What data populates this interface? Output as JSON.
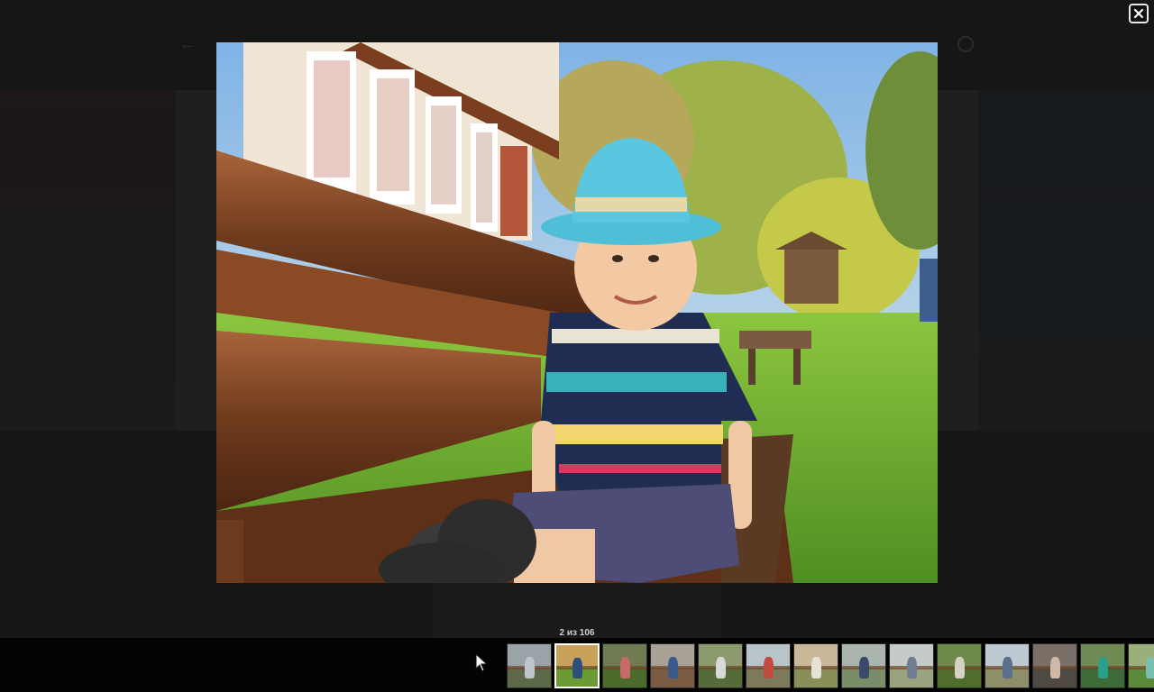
{
  "viewer": {
    "counter": "2 из 106",
    "close_icon": "close-icon"
  },
  "colors": {
    "overlay": "#141414",
    "filmstrip": "#030303",
    "selected_border": "#ffffff"
  },
  "thumbnails": [
    {
      "sky": "#9aa4a8",
      "ground": "#5d6a4a",
      "fig": "#c0c7cc",
      "selected": false
    },
    {
      "sky": "#c8a25a",
      "ground": "#6c9a35",
      "fig": "#2e4f7a",
      "selected": true
    },
    {
      "sky": "#6f7b52",
      "ground": "#4a6b2c",
      "fig": "#c76a6a",
      "selected": false
    },
    {
      "sky": "#a8a195",
      "ground": "#7a5c44",
      "fig": "#3a5a8c",
      "selected": false
    },
    {
      "sky": "#8b9a6d",
      "ground": "#556b3a",
      "fig": "#d9d9d9",
      "selected": false
    },
    {
      "sky": "#b9c4c8",
      "ground": "#7c7a5a",
      "fig": "#c24a3e",
      "selected": false
    },
    {
      "sky": "#c9b89a",
      "ground": "#8a8f5a",
      "fig": "#e8e2d6",
      "selected": false
    },
    {
      "sky": "#a9b5ad",
      "ground": "#7a8c6a",
      "fig": "#3b4a6a",
      "selected": false
    },
    {
      "sky": "#c5cbc8",
      "ground": "#9aa37f",
      "fig": "#6f7f8f",
      "selected": false
    },
    {
      "sky": "#6e8a4a",
      "ground": "#4f6e2e",
      "fig": "#d7d0c4",
      "selected": false
    },
    {
      "sky": "#bfc9d1",
      "ground": "#8e8f6a",
      "fig": "#5a6f8a",
      "selected": false
    },
    {
      "sky": "#7a7068",
      "ground": "#4e4a42",
      "fig": "#d0b8a6",
      "selected": false
    },
    {
      "sky": "#6f8a52",
      "ground": "#3f6a3a",
      "fig": "#2aa08a",
      "selected": false
    },
    {
      "sky": "#9ab07a",
      "ground": "#5a8a3a",
      "fig": "#7ac0b0",
      "selected": false
    }
  ]
}
